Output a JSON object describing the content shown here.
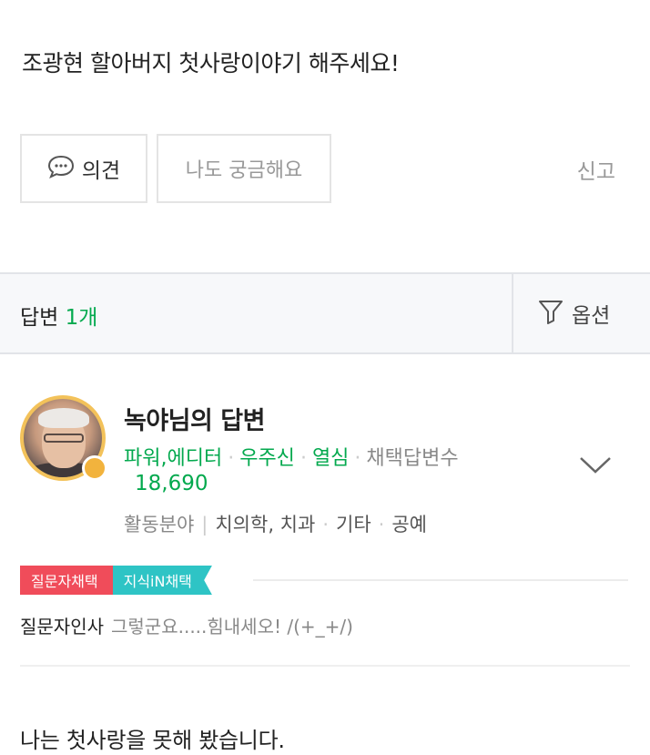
{
  "question": {
    "title": "조광현 할아버지 첫사랑이야기 해주세요!"
  },
  "actions": {
    "opinion_label": "의견",
    "curious_label": "나도 궁금해요",
    "report_label": "신고"
  },
  "answers_header": {
    "label": "답변",
    "count": "1개",
    "option_label": "옵션"
  },
  "answer": {
    "nickname": "녹야님의 답변",
    "grade": "파워,에디터",
    "level": "우주신",
    "badge": "열심",
    "adopted_label": "채택답변수",
    "adopted_count": "18,690",
    "field_label": "활동분야",
    "field_items": [
      "치의학, 치과",
      "기타",
      "공예"
    ],
    "tags": [
      "질문자채택",
      "지식iN채택"
    ],
    "greeting_label": "질문자인사",
    "greeting_text": "그렇군요.....힘내세오! /(+_+/)",
    "body": "나는 첫사랑을 못해 봤습니다."
  },
  "colors": {
    "accent_green": "#03a94e",
    "tag_red": "#f04c5a",
    "tag_teal": "#2ec4c5",
    "avatar_ring": "#f3c25a"
  },
  "icons": {
    "opinion": "speech-bubble-icon",
    "option": "filter-funnel-icon",
    "expand": "chevron-down-icon"
  }
}
